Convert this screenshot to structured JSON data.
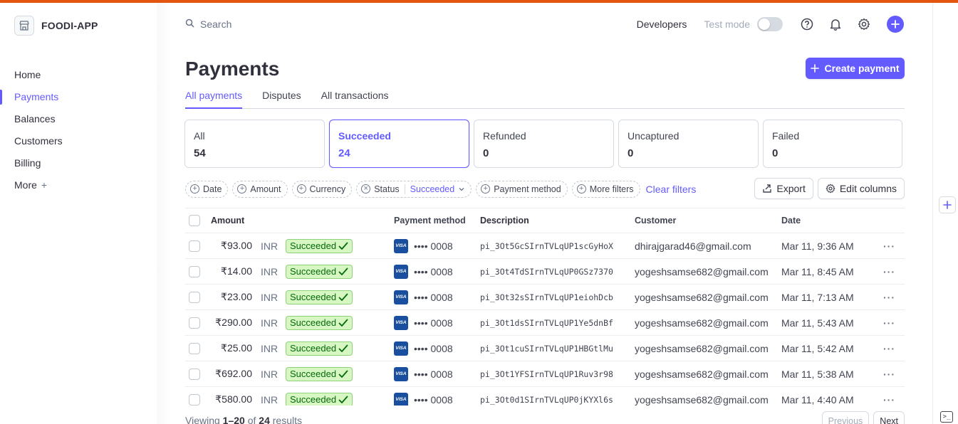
{
  "brand": {
    "name": "FOODI-APP"
  },
  "sidebar": {
    "items": [
      {
        "label": "Home"
      },
      {
        "label": "Payments"
      },
      {
        "label": "Balances"
      },
      {
        "label": "Customers"
      },
      {
        "label": "Billing"
      },
      {
        "label": "More"
      }
    ],
    "active": "Payments"
  },
  "header": {
    "search_placeholder": "Search",
    "developers": "Developers",
    "test_mode": "Test mode",
    "test_mode_on": false
  },
  "page": {
    "title": "Payments",
    "create_button": "Create payment",
    "tabs": [
      {
        "label": "All payments"
      },
      {
        "label": "Disputes"
      },
      {
        "label": "All transactions"
      }
    ]
  },
  "status_cards": [
    {
      "label": "All",
      "count": "54"
    },
    {
      "label": "Succeeded",
      "count": "24"
    },
    {
      "label": "Refunded",
      "count": "0"
    },
    {
      "label": "Uncaptured",
      "count": "0"
    },
    {
      "label": "Failed",
      "count": "0"
    }
  ],
  "filters": {
    "date": "Date",
    "amount": "Amount",
    "currency": "Currency",
    "status": "Status",
    "status_value": "Succeeded",
    "payment_method": "Payment method",
    "more_filters": "More filters",
    "clear": "Clear filters",
    "export": "Export",
    "edit_columns": "Edit columns"
  },
  "table": {
    "headers": {
      "amount": "Amount",
      "payment_method": "Payment method",
      "description": "Description",
      "customer": "Customer",
      "date": "Date"
    },
    "rows": [
      {
        "amount": "₹93.00",
        "currency": "INR",
        "status": "Succeeded",
        "card_brand": "VISA",
        "card_last4": "•••• 0008",
        "description": "pi_3Ot5GcSIrnTVLqUP1scGyHoX",
        "customer": "dhirajgarad46@gmail.com",
        "date": "Mar 11, 9:36 AM"
      },
      {
        "amount": "₹14.00",
        "currency": "INR",
        "status": "Succeeded",
        "card_brand": "VISA",
        "card_last4": "•••• 0008",
        "description": "pi_3Ot4TdSIrnTVLqUP0GSz7370",
        "customer": "yogeshsamse682@gmail.com",
        "date": "Mar 11, 8:45 AM"
      },
      {
        "amount": "₹23.00",
        "currency": "INR",
        "status": "Succeeded",
        "card_brand": "VISA",
        "card_last4": "•••• 0008",
        "description": "pi_3Ot32sSIrnTVLqUP1eiohDcb",
        "customer": "yogeshsamse682@gmail.com",
        "date": "Mar 11, 7:13 AM"
      },
      {
        "amount": "₹290.00",
        "currency": "INR",
        "status": "Succeeded",
        "card_brand": "VISA",
        "card_last4": "•••• 0008",
        "description": "pi_3Ot1dsSIrnTVLqUP1Ye5dnBf",
        "customer": "yogeshsamse682@gmail.com",
        "date": "Mar 11, 5:43 AM"
      },
      {
        "amount": "₹25.00",
        "currency": "INR",
        "status": "Succeeded",
        "card_brand": "VISA",
        "card_last4": "•••• 0008",
        "description": "pi_3Ot1cuSIrnTVLqUP1HBGtlMu",
        "customer": "yogeshsamse682@gmail.com",
        "date": "Mar 11, 5:42 AM"
      },
      {
        "amount": "₹692.00",
        "currency": "INR",
        "status": "Succeeded",
        "card_brand": "VISA",
        "card_last4": "•••• 0008",
        "description": "pi_3Ot1YFSIrnTVLqUP1Ruv3r98",
        "customer": "yogeshsamse682@gmail.com",
        "date": "Mar 11, 5:38 AM"
      },
      {
        "amount": "₹580.00",
        "currency": "INR",
        "status": "Succeeded",
        "card_brand": "VISA",
        "card_last4": "•••• 0008",
        "description": "pi_3Ot0d1SIrnTVLqUP0jKYXl6s",
        "customer": "yogeshsamse682@gmail.com",
        "date": "Mar 11, 4:40 AM"
      }
    ]
  },
  "footer": {
    "viewing_prefix": "Viewing",
    "range": "1–20",
    "of": "of",
    "total": "24",
    "results": "results",
    "previous": "Previous",
    "next": "Next"
  },
  "colors": {
    "accent": "#635bff",
    "top_bar": "#e3560f",
    "success_bg": "#d7f7c2",
    "success_text": "#05690d"
  },
  "icons": [
    "store-icon",
    "search-icon",
    "help-icon",
    "bell-icon",
    "gear-icon",
    "plus-icon",
    "export-icon",
    "gear-icon",
    "check-icon",
    "visa-icon",
    "more-icon",
    "terminal-icon"
  ]
}
